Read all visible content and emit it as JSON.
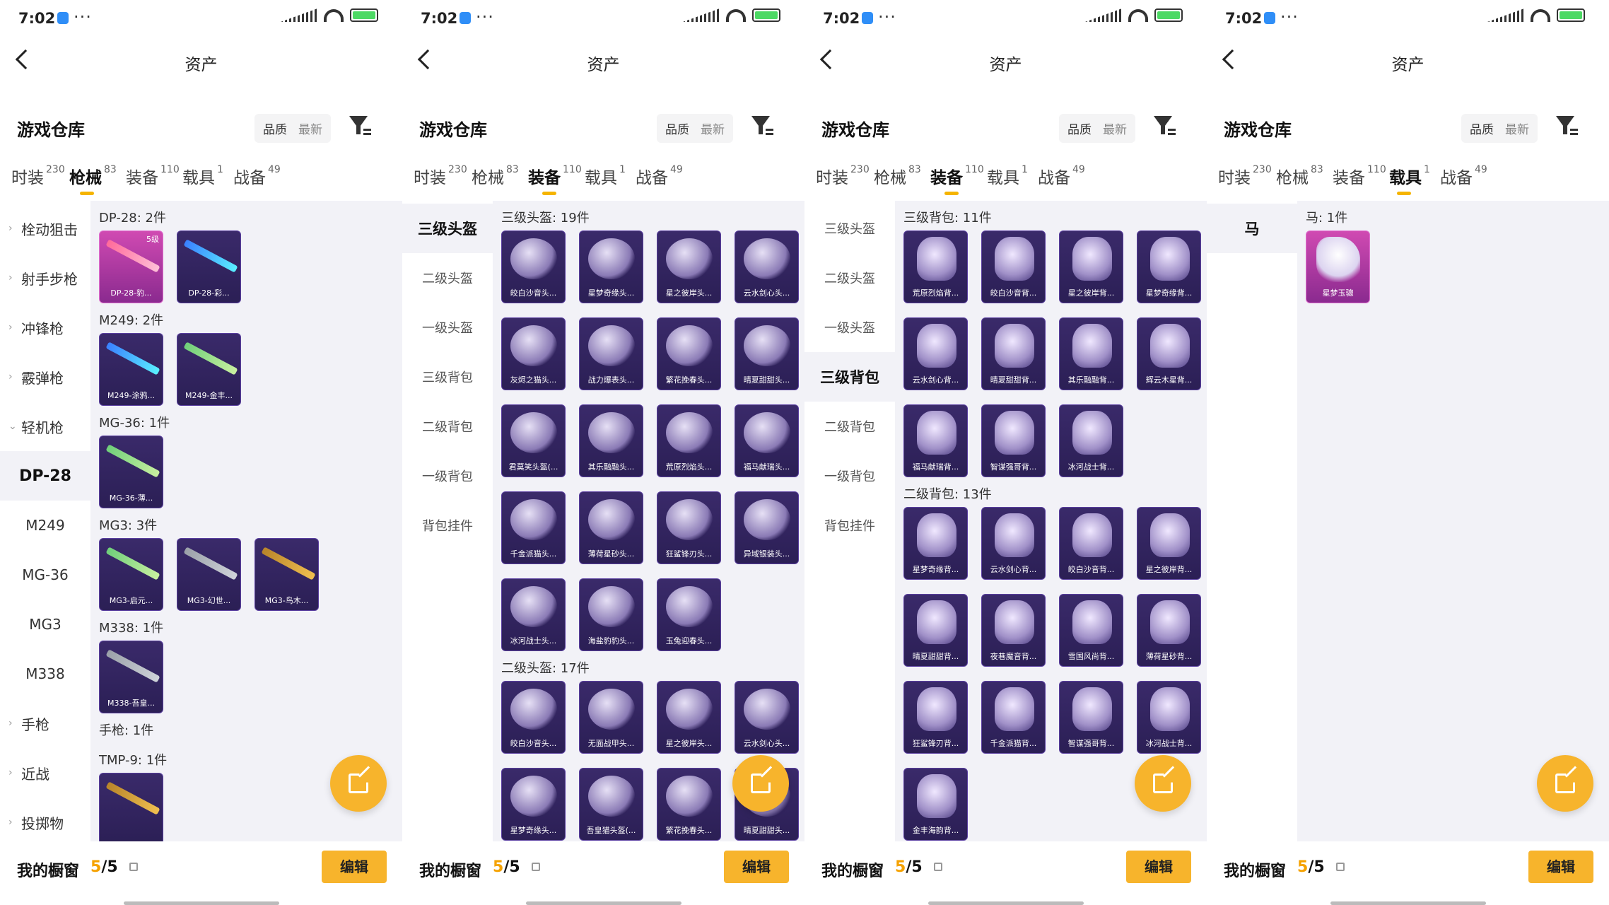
{
  "status": {
    "time": "7:02",
    "dots": "···",
    "battery": "81"
  },
  "nav": {
    "title": "资产"
  },
  "header": {
    "title": "游戏仓库",
    "sort_quality": "品质",
    "sort_latest": "最新"
  },
  "tabs": [
    {
      "label": "时装",
      "count": "230"
    },
    {
      "label": "枪械",
      "count": "83"
    },
    {
      "label": "装备",
      "count": "110"
    },
    {
      "label": "载具",
      "count": "1"
    },
    {
      "label": "战备",
      "count": "49"
    }
  ],
  "footer": {
    "showcase": "我的橱窗",
    "count_current": "5",
    "count_sep": "/5",
    "edit": "编辑"
  },
  "panels": [
    {
      "active_tab": 1,
      "sidebar": [
        {
          "label": "栓动狙击",
          "type": "parent"
        },
        {
          "label": "射手步枪",
          "type": "parent"
        },
        {
          "label": "冲锋枪",
          "type": "parent"
        },
        {
          "label": "霰弹枪",
          "type": "parent"
        },
        {
          "label": "轻机枪",
          "type": "parent-open"
        },
        {
          "label": "DP-28",
          "type": "sub-sel"
        },
        {
          "label": "M249",
          "type": "sub"
        },
        {
          "label": "MG-36",
          "type": "sub"
        },
        {
          "label": "MG3",
          "type": "sub"
        },
        {
          "label": "M338",
          "type": "sub"
        },
        {
          "label": "手枪",
          "type": "parent"
        },
        {
          "label": "近战",
          "type": "parent"
        },
        {
          "label": "投掷物",
          "type": "parent"
        }
      ],
      "sections": [
        {
          "title": "DP-28: 2件",
          "items": [
            {
              "name": "DP-28-豹...",
              "style": "legend",
              "art": "gun pink",
              "level": "5级"
            },
            {
              "name": "DP-28-彩...",
              "style": "",
              "art": "gun blue"
            }
          ]
        },
        {
          "title": "M249: 2件",
          "items": [
            {
              "name": "M249-涂鸦...",
              "style": "",
              "art": "gun blue"
            },
            {
              "name": "M249-金丰...",
              "style": "",
              "art": "gun green"
            }
          ]
        },
        {
          "title": "MG-36: 1件",
          "items": [
            {
              "name": "MG-36-薄...",
              "style": "",
              "art": "gun green"
            }
          ]
        },
        {
          "title": "MG3: 3件",
          "items": [
            {
              "name": "MG3-启元...",
              "style": "",
              "art": "gun green"
            },
            {
              "name": "MG3-幻世...",
              "style": "",
              "art": "gun"
            },
            {
              "name": "MG3-鸟木...",
              "style": "",
              "art": "gun gold"
            }
          ]
        },
        {
          "title": "M338: 1件",
          "items": [
            {
              "name": "M338-吾皇...",
              "style": "",
              "art": "gun"
            }
          ]
        },
        {
          "title": "手枪: 1件",
          "items": []
        },
        {
          "title": "TMP-9: 1件",
          "items": [
            {
              "name": "",
              "style": "",
              "art": "gun gold"
            }
          ]
        }
      ]
    },
    {
      "active_tab": 2,
      "sidebar": [
        {
          "label": "三级头盔",
          "type": "cat-sel"
        },
        {
          "label": "二级头盔",
          "type": "cat"
        },
        {
          "label": "一级头盔",
          "type": "cat"
        },
        {
          "label": "三级背包",
          "type": "cat"
        },
        {
          "label": "二级背包",
          "type": "cat"
        },
        {
          "label": "一级背包",
          "type": "cat"
        },
        {
          "label": "背包挂件",
          "type": "cat"
        }
      ],
      "sections": [
        {
          "title": "三级头盔: 19件",
          "items": [
            {
              "name": "皎白沙音头...",
              "art": "art"
            },
            {
              "name": "星梦奇缘头...",
              "art": "art"
            },
            {
              "name": "星之彼岸头...",
              "art": "art"
            },
            {
              "name": "云水剑心头...",
              "art": "art"
            },
            {
              "name": "灰烬之猫头...",
              "art": "art"
            },
            {
              "name": "战力爆表头...",
              "art": "art"
            },
            {
              "name": "繁花挽春头...",
              "art": "art"
            },
            {
              "name": "晴夏甜甜头...",
              "art": "art"
            },
            {
              "name": "君莫笑头盔(...",
              "art": "art"
            },
            {
              "name": "其乐融融头...",
              "art": "art"
            },
            {
              "name": "荒原烈焰头...",
              "art": "art"
            },
            {
              "name": "福马献瑞头...",
              "art": "art"
            },
            {
              "name": "千金派猫头...",
              "art": "art"
            },
            {
              "name": "薄荷星砂头...",
              "art": "art"
            },
            {
              "name": "狂鲨锋刃头...",
              "art": "art"
            },
            {
              "name": "异域银装头...",
              "art": "art"
            },
            {
              "name": "冰河战士头...",
              "art": "art"
            },
            {
              "name": "海盐豹豹头...",
              "art": "art"
            },
            {
              "name": "玉兔迎春头...",
              "art": "art"
            }
          ]
        },
        {
          "title": "二级头盔: 17件",
          "items": [
            {
              "name": "皎白沙音头...",
              "art": "art"
            },
            {
              "name": "无面战甲头...",
              "art": "art"
            },
            {
              "name": "星之彼岸头...",
              "art": "art"
            },
            {
              "name": "云水剑心头...",
              "art": "art"
            },
            {
              "name": "星梦奇缘头...",
              "art": "art"
            },
            {
              "name": "吾皇猫头盔(...",
              "art": "art"
            },
            {
              "name": "繁花挽春头...",
              "art": "art"
            },
            {
              "name": "晴夏甜甜头...",
              "art": "art"
            }
          ]
        }
      ]
    },
    {
      "active_tab": 2,
      "sidebar": [
        {
          "label": "三级头盔",
          "type": "cat"
        },
        {
          "label": "二级头盔",
          "type": "cat"
        },
        {
          "label": "一级头盔",
          "type": "cat"
        },
        {
          "label": "三级背包",
          "type": "cat-sel"
        },
        {
          "label": "二级背包",
          "type": "cat"
        },
        {
          "label": "一级背包",
          "type": "cat"
        },
        {
          "label": "背包挂件",
          "type": "cat"
        }
      ],
      "sections": [
        {
          "title": "三级背包: 11件",
          "items": [
            {
              "name": "荒原烈焰背...",
              "art": "bag"
            },
            {
              "name": "皎白沙音背...",
              "art": "bag"
            },
            {
              "name": "星之彼岸背...",
              "art": "bag"
            },
            {
              "name": "星梦奇缘背...",
              "art": "bag"
            },
            {
              "name": "云水剑心背...",
              "art": "bag"
            },
            {
              "name": "晴夏甜甜背...",
              "art": "bag"
            },
            {
              "name": "其乐融融背...",
              "art": "bag"
            },
            {
              "name": "辉云木星背...",
              "art": "bag"
            },
            {
              "name": "福马献瑞背...",
              "art": "bag"
            },
            {
              "name": "智谋强哥背...",
              "art": "bag"
            },
            {
              "name": "冰河战士背...",
              "art": "bag"
            }
          ]
        },
        {
          "title": "二级背包: 13件",
          "items": [
            {
              "name": "星梦奇缘背...",
              "art": "bag"
            },
            {
              "name": "云水剑心背...",
              "art": "bag"
            },
            {
              "name": "皎白沙音背...",
              "art": "bag"
            },
            {
              "name": "星之彼岸背...",
              "art": "bag"
            },
            {
              "name": "晴夏甜甜背...",
              "art": "bag"
            },
            {
              "name": "夜巷魔音背...",
              "art": "bag"
            },
            {
              "name": "雪国风尚背...",
              "art": "bag"
            },
            {
              "name": "薄荷星砂背...",
              "art": "bag"
            },
            {
              "name": "狂鲨锋刃背...",
              "art": "bag"
            },
            {
              "name": "千金派猫背...",
              "art": "bag"
            },
            {
              "name": "智谋强哥背...",
              "art": "bag"
            },
            {
              "name": "冰河战士背...",
              "art": "bag"
            },
            {
              "name": "金丰海韵背...",
              "art": "bag"
            }
          ]
        }
      ]
    },
    {
      "active_tab": 3,
      "sidebar": [
        {
          "label": "马",
          "type": "cat-sel"
        }
      ],
      "sections": [
        {
          "title": "马: 1件",
          "items": [
            {
              "name": "星梦玉骢",
              "style": "legend",
              "art": "horse"
            }
          ]
        }
      ]
    }
  ]
}
